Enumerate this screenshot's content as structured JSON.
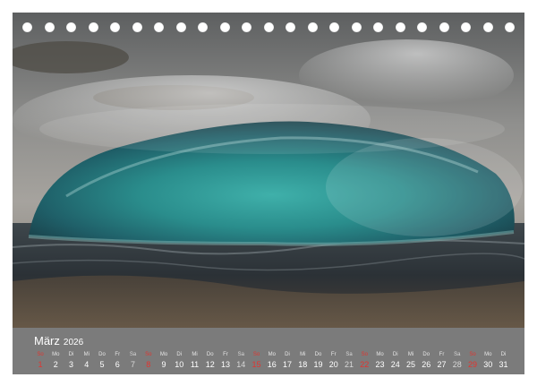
{
  "calendar": {
    "month": "März",
    "year": "2026",
    "days": [
      {
        "dow": "So",
        "num": "1",
        "type": "sun"
      },
      {
        "dow": "Mo",
        "num": "2",
        "type": "wd"
      },
      {
        "dow": "Di",
        "num": "3",
        "type": "wd"
      },
      {
        "dow": "Mi",
        "num": "4",
        "type": "wd"
      },
      {
        "dow": "Do",
        "num": "5",
        "type": "wd"
      },
      {
        "dow": "Fr",
        "num": "6",
        "type": "wd"
      },
      {
        "dow": "Sa",
        "num": "7",
        "type": "sat"
      },
      {
        "dow": "So",
        "num": "8",
        "type": "sun"
      },
      {
        "dow": "Mo",
        "num": "9",
        "type": "wd"
      },
      {
        "dow": "Di",
        "num": "10",
        "type": "wd"
      },
      {
        "dow": "Mi",
        "num": "11",
        "type": "wd"
      },
      {
        "dow": "Do",
        "num": "12",
        "type": "wd"
      },
      {
        "dow": "Fr",
        "num": "13",
        "type": "wd"
      },
      {
        "dow": "Sa",
        "num": "14",
        "type": "sat"
      },
      {
        "dow": "So",
        "num": "15",
        "type": "sun"
      },
      {
        "dow": "Mo",
        "num": "16",
        "type": "wd"
      },
      {
        "dow": "Di",
        "num": "17",
        "type": "wd"
      },
      {
        "dow": "Mi",
        "num": "18",
        "type": "wd"
      },
      {
        "dow": "Do",
        "num": "19",
        "type": "wd"
      },
      {
        "dow": "Fr",
        "num": "20",
        "type": "wd"
      },
      {
        "dow": "Sa",
        "num": "21",
        "type": "sat"
      },
      {
        "dow": "So",
        "num": "22",
        "type": "sun"
      },
      {
        "dow": "Mo",
        "num": "23",
        "type": "wd"
      },
      {
        "dow": "Di",
        "num": "24",
        "type": "wd"
      },
      {
        "dow": "Mi",
        "num": "25",
        "type": "wd"
      },
      {
        "dow": "Do",
        "num": "26",
        "type": "wd"
      },
      {
        "dow": "Fr",
        "num": "27",
        "type": "wd"
      },
      {
        "dow": "Sa",
        "num": "28",
        "type": "sat"
      },
      {
        "dow": "So",
        "num": "29",
        "type": "sun"
      },
      {
        "dow": "Mo",
        "num": "30",
        "type": "wd"
      },
      {
        "dow": "Di",
        "num": "31",
        "type": "wd"
      }
    ]
  },
  "colors": {
    "sunday": "#e3342f",
    "calendar_bar": "#7b7b7b",
    "bubble": "#2f8f8c"
  }
}
